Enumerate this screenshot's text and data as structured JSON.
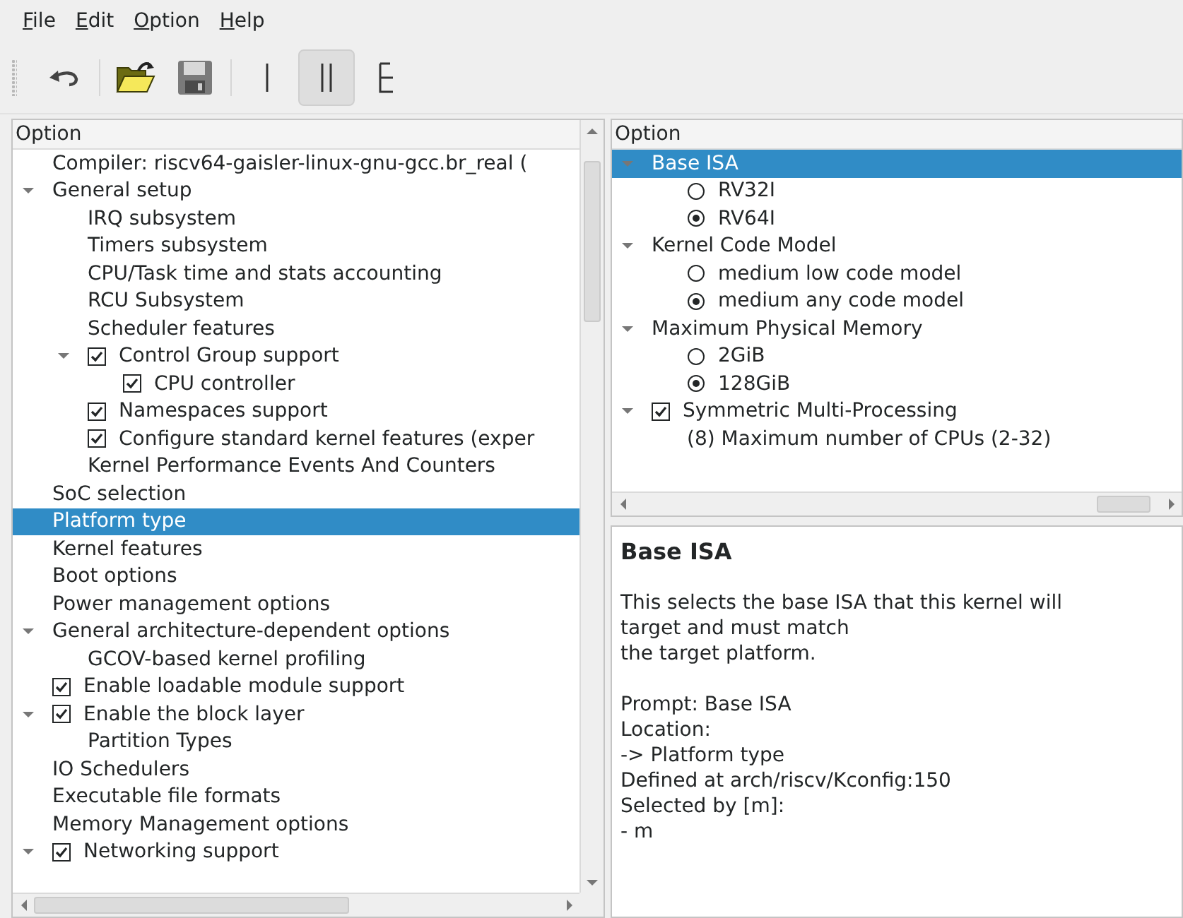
{
  "menu_bar": [
    {
      "label": "File"
    },
    {
      "label": "Edit"
    },
    {
      "label": "Option"
    },
    {
      "label": "Help"
    }
  ],
  "toolbar": [
    {
      "kind": "back",
      "selected": false
    },
    {
      "kind": "open",
      "selected": false
    },
    {
      "kind": "save",
      "selected": false
    },
    {
      "kind": "single-view",
      "selected": false
    },
    {
      "kind": "split-view",
      "selected": true
    },
    {
      "kind": "full-view",
      "selected": false
    }
  ],
  "menu_tree": {
    "header": "Option",
    "items": [
      {
        "kind": "comment",
        "label": "Compiler: riscv64-gaisler-linux-gnu-gcc.br_real (",
        "selected": false
      },
      {
        "kind": "menu",
        "label": "General setup",
        "selected": false,
        "expanded": true,
        "children": [
          {
            "kind": "menu",
            "label": "IRQ subsystem",
            "selected": false
          },
          {
            "kind": "menu",
            "label": "Timers subsystem",
            "selected": false
          },
          {
            "kind": "menu",
            "label": "CPU/Task time and stats accounting",
            "selected": false
          },
          {
            "kind": "menu",
            "label": "RCU Subsystem",
            "selected": false
          },
          {
            "kind": "menu",
            "label": "Scheduler features",
            "selected": false
          },
          {
            "kind": "check",
            "label": "Control Group support",
            "selected": false,
            "checked": true,
            "expanded": true,
            "children": [
              {
                "kind": "check",
                "label": "CPU controller",
                "selected": false,
                "checked": true
              }
            ]
          },
          {
            "kind": "check",
            "label": "Namespaces support",
            "selected": false,
            "checked": true
          },
          {
            "kind": "check",
            "label": "Configure standard kernel features (exper",
            "selected": false,
            "checked": true
          },
          {
            "kind": "menu",
            "label": "Kernel Performance Events And Counters",
            "selected": false
          }
        ]
      },
      {
        "kind": "menu",
        "label": "SoC selection",
        "selected": false
      },
      {
        "kind": "menu",
        "label": "Platform type",
        "selected": true
      },
      {
        "kind": "menu",
        "label": "Kernel features",
        "selected": false
      },
      {
        "kind": "menu",
        "label": "Boot options",
        "selected": false
      },
      {
        "kind": "menu",
        "label": "Power management options",
        "selected": false
      },
      {
        "kind": "menu",
        "label": "General architecture-dependent options",
        "selected": false,
        "expanded": true,
        "children": [
          {
            "kind": "menu",
            "label": "GCOV-based kernel profiling",
            "selected": false
          }
        ]
      },
      {
        "kind": "check",
        "label": "Enable loadable module support",
        "selected": false,
        "checked": true
      },
      {
        "kind": "check",
        "label": "Enable the block layer",
        "selected": false,
        "checked": true,
        "expanded": true,
        "children": [
          {
            "kind": "menu",
            "label": "Partition Types",
            "selected": false
          }
        ]
      },
      {
        "kind": "menu",
        "label": "IO Schedulers",
        "selected": false
      },
      {
        "kind": "menu",
        "label": "Executable file formats",
        "selected": false
      },
      {
        "kind": "menu",
        "label": "Memory Management options",
        "selected": false
      },
      {
        "kind": "check",
        "label": "Networking support",
        "selected": false,
        "checked": true,
        "expanded": true
      }
    ]
  },
  "option_tree": {
    "header": "Option",
    "items": [
      {
        "kind": "menu",
        "label": "Base ISA",
        "selected": true,
        "expanded": true,
        "children": [
          {
            "kind": "radio",
            "label": "RV32I",
            "selected": false,
            "checked": false
          },
          {
            "kind": "radio",
            "label": "RV64I",
            "selected": false,
            "checked": true
          }
        ]
      },
      {
        "kind": "menu",
        "label": "Kernel Code Model",
        "selected": false,
        "expanded": true,
        "children": [
          {
            "kind": "radio",
            "label": "medium low code model",
            "selected": false,
            "checked": false
          },
          {
            "kind": "radio",
            "label": "medium any code model",
            "selected": false,
            "checked": true
          }
        ]
      },
      {
        "kind": "menu",
        "label": "Maximum Physical Memory",
        "selected": false,
        "expanded": true,
        "children": [
          {
            "kind": "radio",
            "label": "2GiB",
            "selected": false,
            "checked": false
          },
          {
            "kind": "radio",
            "label": "128GiB",
            "selected": false,
            "checked": true
          }
        ]
      },
      {
        "kind": "check",
        "label": "Symmetric Multi-Processing",
        "selected": false,
        "checked": true,
        "expanded": true,
        "children": [
          {
            "kind": "value",
            "label": "(8) Maximum number of CPUs (2-32)",
            "selected": false
          }
        ]
      }
    ]
  },
  "info": {
    "title": "Base ISA",
    "paragraphs": [
      [
        "This selects the base ISA that this kernel will",
        "target and must match",
        "the target platform."
      ],
      [
        "Prompt: Base ISA",
        "Location:",
        "-> Platform type",
        "Defined at arch/riscv/Kconfig:150",
        "Selected by [m]:",
        "- m"
      ]
    ]
  }
}
